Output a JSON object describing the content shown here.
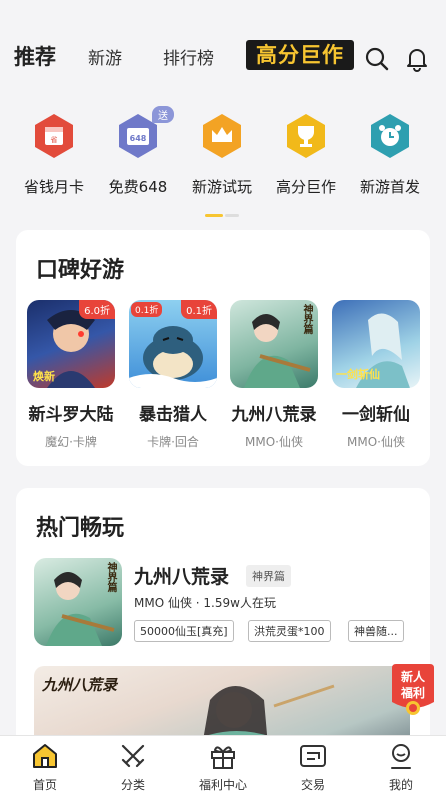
{
  "top_tabs": {
    "recommend": "推荐",
    "new_games": "新游",
    "ranking": "排行榜",
    "brand_banner": "高分巨作"
  },
  "quick_entries": [
    {
      "label": "省钱月卡",
      "icon": "card-icon",
      "color": "#e24b3b"
    },
    {
      "label": "免费648",
      "icon": "648-icon",
      "color": "#6f79c9",
      "tag": "送"
    },
    {
      "label": "新游试玩",
      "icon": "crown-icon",
      "color": "#f3a324"
    },
    {
      "label": "高分巨作",
      "icon": "trophy-icon",
      "color": "#f1b91a"
    },
    {
      "label": "新游首发",
      "icon": "alarm-icon",
      "color": "#2e9fb0"
    }
  ],
  "reputation": {
    "title": "口碑好游",
    "games": [
      {
        "name": "新斗罗大陆",
        "genre": "魔幻·卡牌",
        "discount": "6.0折",
        "cover_text": "焕新"
      },
      {
        "name": "暴击猎人",
        "genre": "卡牌·回合",
        "discount": "0.1折",
        "cover_badge": "0.1折"
      },
      {
        "name": "九州八荒录",
        "genre": "MMO·仙侠",
        "cover_text": "神界篇"
      },
      {
        "name": "一剑斩仙",
        "genre": "MMO·仙侠",
        "cover_text": "一剑斩仙"
      }
    ]
  },
  "hot": {
    "title": "热门畅玩",
    "item": {
      "name": "九州八荒录",
      "subtitle": "神界篇",
      "meta": "MMO 仙侠 · 1.59w人在玩",
      "chips": [
        "50000仙玉[真充]",
        "洪荒灵蛋*100",
        "神兽随..."
      ],
      "cover_text": "神界篇"
    },
    "banner_text": "九州八荒录"
  },
  "floating_badge": {
    "line1": "新人",
    "line2": "福利"
  },
  "bottom_nav": [
    {
      "label": "首页",
      "icon": "home-icon"
    },
    {
      "label": "分类",
      "icon": "swords-icon"
    },
    {
      "label": "福利中心",
      "icon": "gift-icon"
    },
    {
      "label": "交易",
      "icon": "trade-icon"
    },
    {
      "label": "我的",
      "icon": "profile-icon"
    }
  ],
  "colors": {
    "accent": "#f7c531",
    "discount_red": "#e8443a"
  }
}
